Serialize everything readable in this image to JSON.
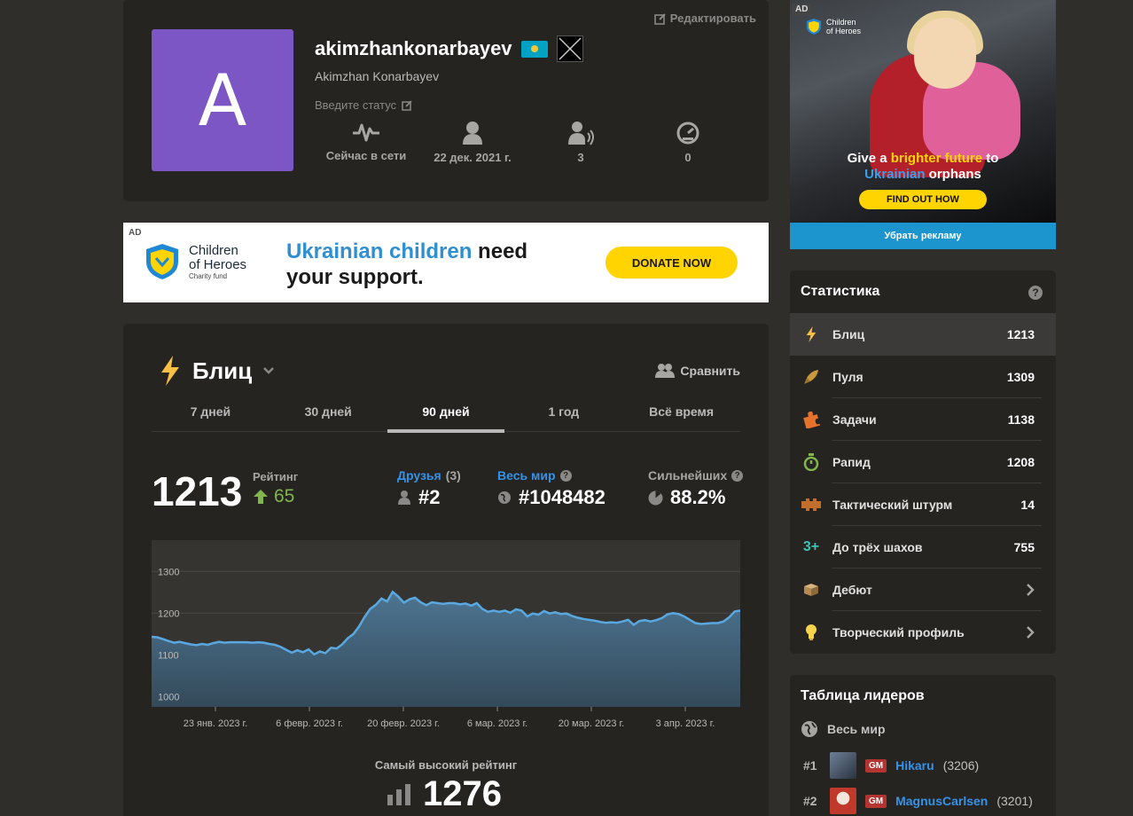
{
  "profile": {
    "avatar_letter": "A",
    "username": "akimzhankonarbayev",
    "real_name": "Akimzhan Konarbayev",
    "status_placeholder": "Введите статус",
    "edit_label": "Редактировать",
    "stats": [
      {
        "icon": "activity-icon",
        "value": "Сейчас в сети"
      },
      {
        "icon": "person-icon",
        "value": "22 дек. 2021 г."
      },
      {
        "icon": "followers-icon",
        "value": "3"
      },
      {
        "icon": "points-icon",
        "value": "0"
      }
    ]
  },
  "banner_ad": {
    "tag": "AD",
    "logo_line1": "Children",
    "logo_line2": "of Heroes",
    "logo_sub": "Charity fund",
    "headline_highlight": "Ukrainian children",
    "headline_rest1": " need",
    "headline_rest2": "your support.",
    "button": "DONATE NOW"
  },
  "rating_card": {
    "mode": "Блиц",
    "compare": "Сравнить",
    "tabs": [
      "7 дней",
      "30 дней",
      "90 дней",
      "1 год",
      "Всё время"
    ],
    "active_tab": "90 дней",
    "rating": "1213",
    "rating_label": "Рейтинг",
    "rating_delta": "65",
    "friends_label": "Друзья",
    "friends_count": "(3)",
    "friends_rank": "#2",
    "world_label": "Весь мир",
    "world_rank": "#1048482",
    "better_label": "Сильнейших",
    "better_pct": "88.2%",
    "best_label": "Самый высокий рейтинг",
    "best_value": "1276"
  },
  "chart_data": {
    "type": "area",
    "y_ticks": [
      "1300",
      "1200",
      "1100",
      "1000"
    ],
    "x_labels": [
      "23 янв. 2023 г.",
      "6 февр. 2023 г.",
      "20 февр. 2023 г.",
      "6 мар. 2023 г.",
      "20 мар. 2023 г.",
      "3 апр. 2023 г."
    ],
    "ylim": [
      975,
      1375
    ],
    "values": [
      1143,
      1142,
      1138,
      1133,
      1129,
      1131,
      1128,
      1125,
      1123,
      1126,
      1124,
      1128,
      1131,
      1129,
      1130,
      1130,
      1130,
      1130,
      1129,
      1130,
      1129,
      1126,
      1124,
      1119,
      1112,
      1105,
      1111,
      1106,
      1113,
      1101,
      1108,
      1104,
      1117,
      1115,
      1125,
      1140,
      1150,
      1168,
      1191,
      1210,
      1220,
      1235,
      1228,
      1251,
      1240,
      1225,
      1233,
      1237,
      1226,
      1219,
      1226,
      1224,
      1222,
      1224,
      1224,
      1221,
      1223,
      1218,
      1224,
      1210,
      1203,
      1206,
      1203,
      1206,
      1201,
      1209,
      1206,
      1192,
      1199,
      1196,
      1205,
      1199,
      1202,
      1198,
      1199,
      1193,
      1189,
      1186,
      1184,
      1182,
      1179,
      1177,
      1178,
      1177,
      1180,
      1184,
      1172,
      1181,
      1183,
      1180,
      1183,
      1188,
      1197,
      1200,
      1198,
      1192,
      1184,
      1176,
      1174,
      1175,
      1176,
      1176,
      1180,
      1190,
      1204,
      1206
    ],
    "colors": {
      "line": "#5aa8e0",
      "fill_top": "#4d7592",
      "fill_bottom": "#344a5a"
    }
  },
  "side_ad": {
    "tag": "AD",
    "logo_line1": "Children",
    "logo_line2": "of Heroes",
    "text_pre": "Give a",
    "text_yellow": " brighter future",
    "text_mid": " to",
    "text_blue": "Ukrainian",
    "text_end": " orphans",
    "button": "FIND OUT HOW",
    "remove": "Убрать рекламу"
  },
  "stats_panel": {
    "title": "Статистика",
    "help": "?",
    "rows": [
      {
        "name": "Блиц",
        "value": "1213",
        "icon": "lightning-icon"
      },
      {
        "name": "Пуля",
        "value": "1309",
        "icon": "bullet-icon"
      },
      {
        "name": "Задачи",
        "value": "1138",
        "icon": "puzzle-icon"
      },
      {
        "name": "Рапид",
        "value": "1208",
        "icon": "rapid-icon"
      },
      {
        "name": "Тактический штурм",
        "value": "14",
        "icon": "puzzle-rush-icon"
      },
      {
        "name": "До трёх шахов",
        "value": "755",
        "icon": "three-check-icon"
      },
      {
        "name": "Дебют",
        "value": "",
        "icon": "opening-icon"
      },
      {
        "name": "Творческий профиль",
        "value": "",
        "icon": "lightbulb-icon"
      }
    ]
  },
  "leaderboard": {
    "title": "Таблица лидеров",
    "scope": "Весь мир",
    "entries": [
      {
        "rank": "#1",
        "title": "GM",
        "name": "Hikaru",
        "rating": "(3206)"
      },
      {
        "rank": "#2",
        "title": "GM",
        "name": "MagnusCarlsen",
        "rating": "(3201)"
      }
    ]
  }
}
